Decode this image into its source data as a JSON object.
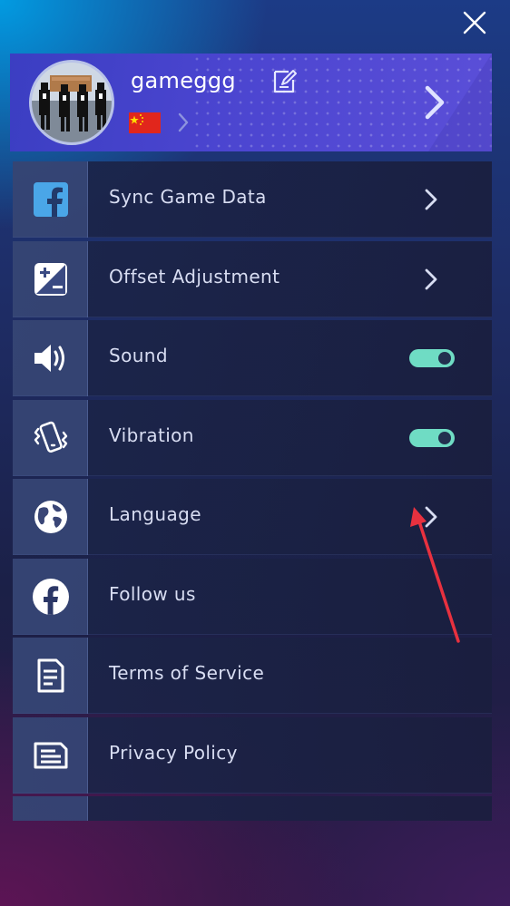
{
  "profile": {
    "username": "gameggg",
    "country_flag": "china-flag-icon"
  },
  "menu": {
    "items": [
      {
        "label": "Sync Game Data",
        "icon": "facebook-square-icon",
        "control": "chevron"
      },
      {
        "label": "Offset Adjustment",
        "icon": "offset-adjust-icon",
        "control": "chevron"
      },
      {
        "label": "Sound",
        "icon": "speaker-icon",
        "control": "toggle",
        "on": true
      },
      {
        "label": "Vibration",
        "icon": "vibration-icon",
        "control": "toggle",
        "on": true
      },
      {
        "label": "Language",
        "icon": "globe-icon",
        "control": "chevron"
      },
      {
        "label": "Follow us",
        "icon": "facebook-circle-icon",
        "control": "none"
      },
      {
        "label": "Terms of Service",
        "icon": "document-icon",
        "control": "none"
      },
      {
        "label": "Privacy Policy",
        "icon": "privacy-doc-icon",
        "control": "none"
      },
      {
        "label": "",
        "icon": "partial-icon",
        "control": "none"
      }
    ]
  },
  "colors": {
    "accent_toggle": "#6fdcc4",
    "profile_bg": "#4b45d0",
    "annotation_arrow": "#e8313f"
  }
}
